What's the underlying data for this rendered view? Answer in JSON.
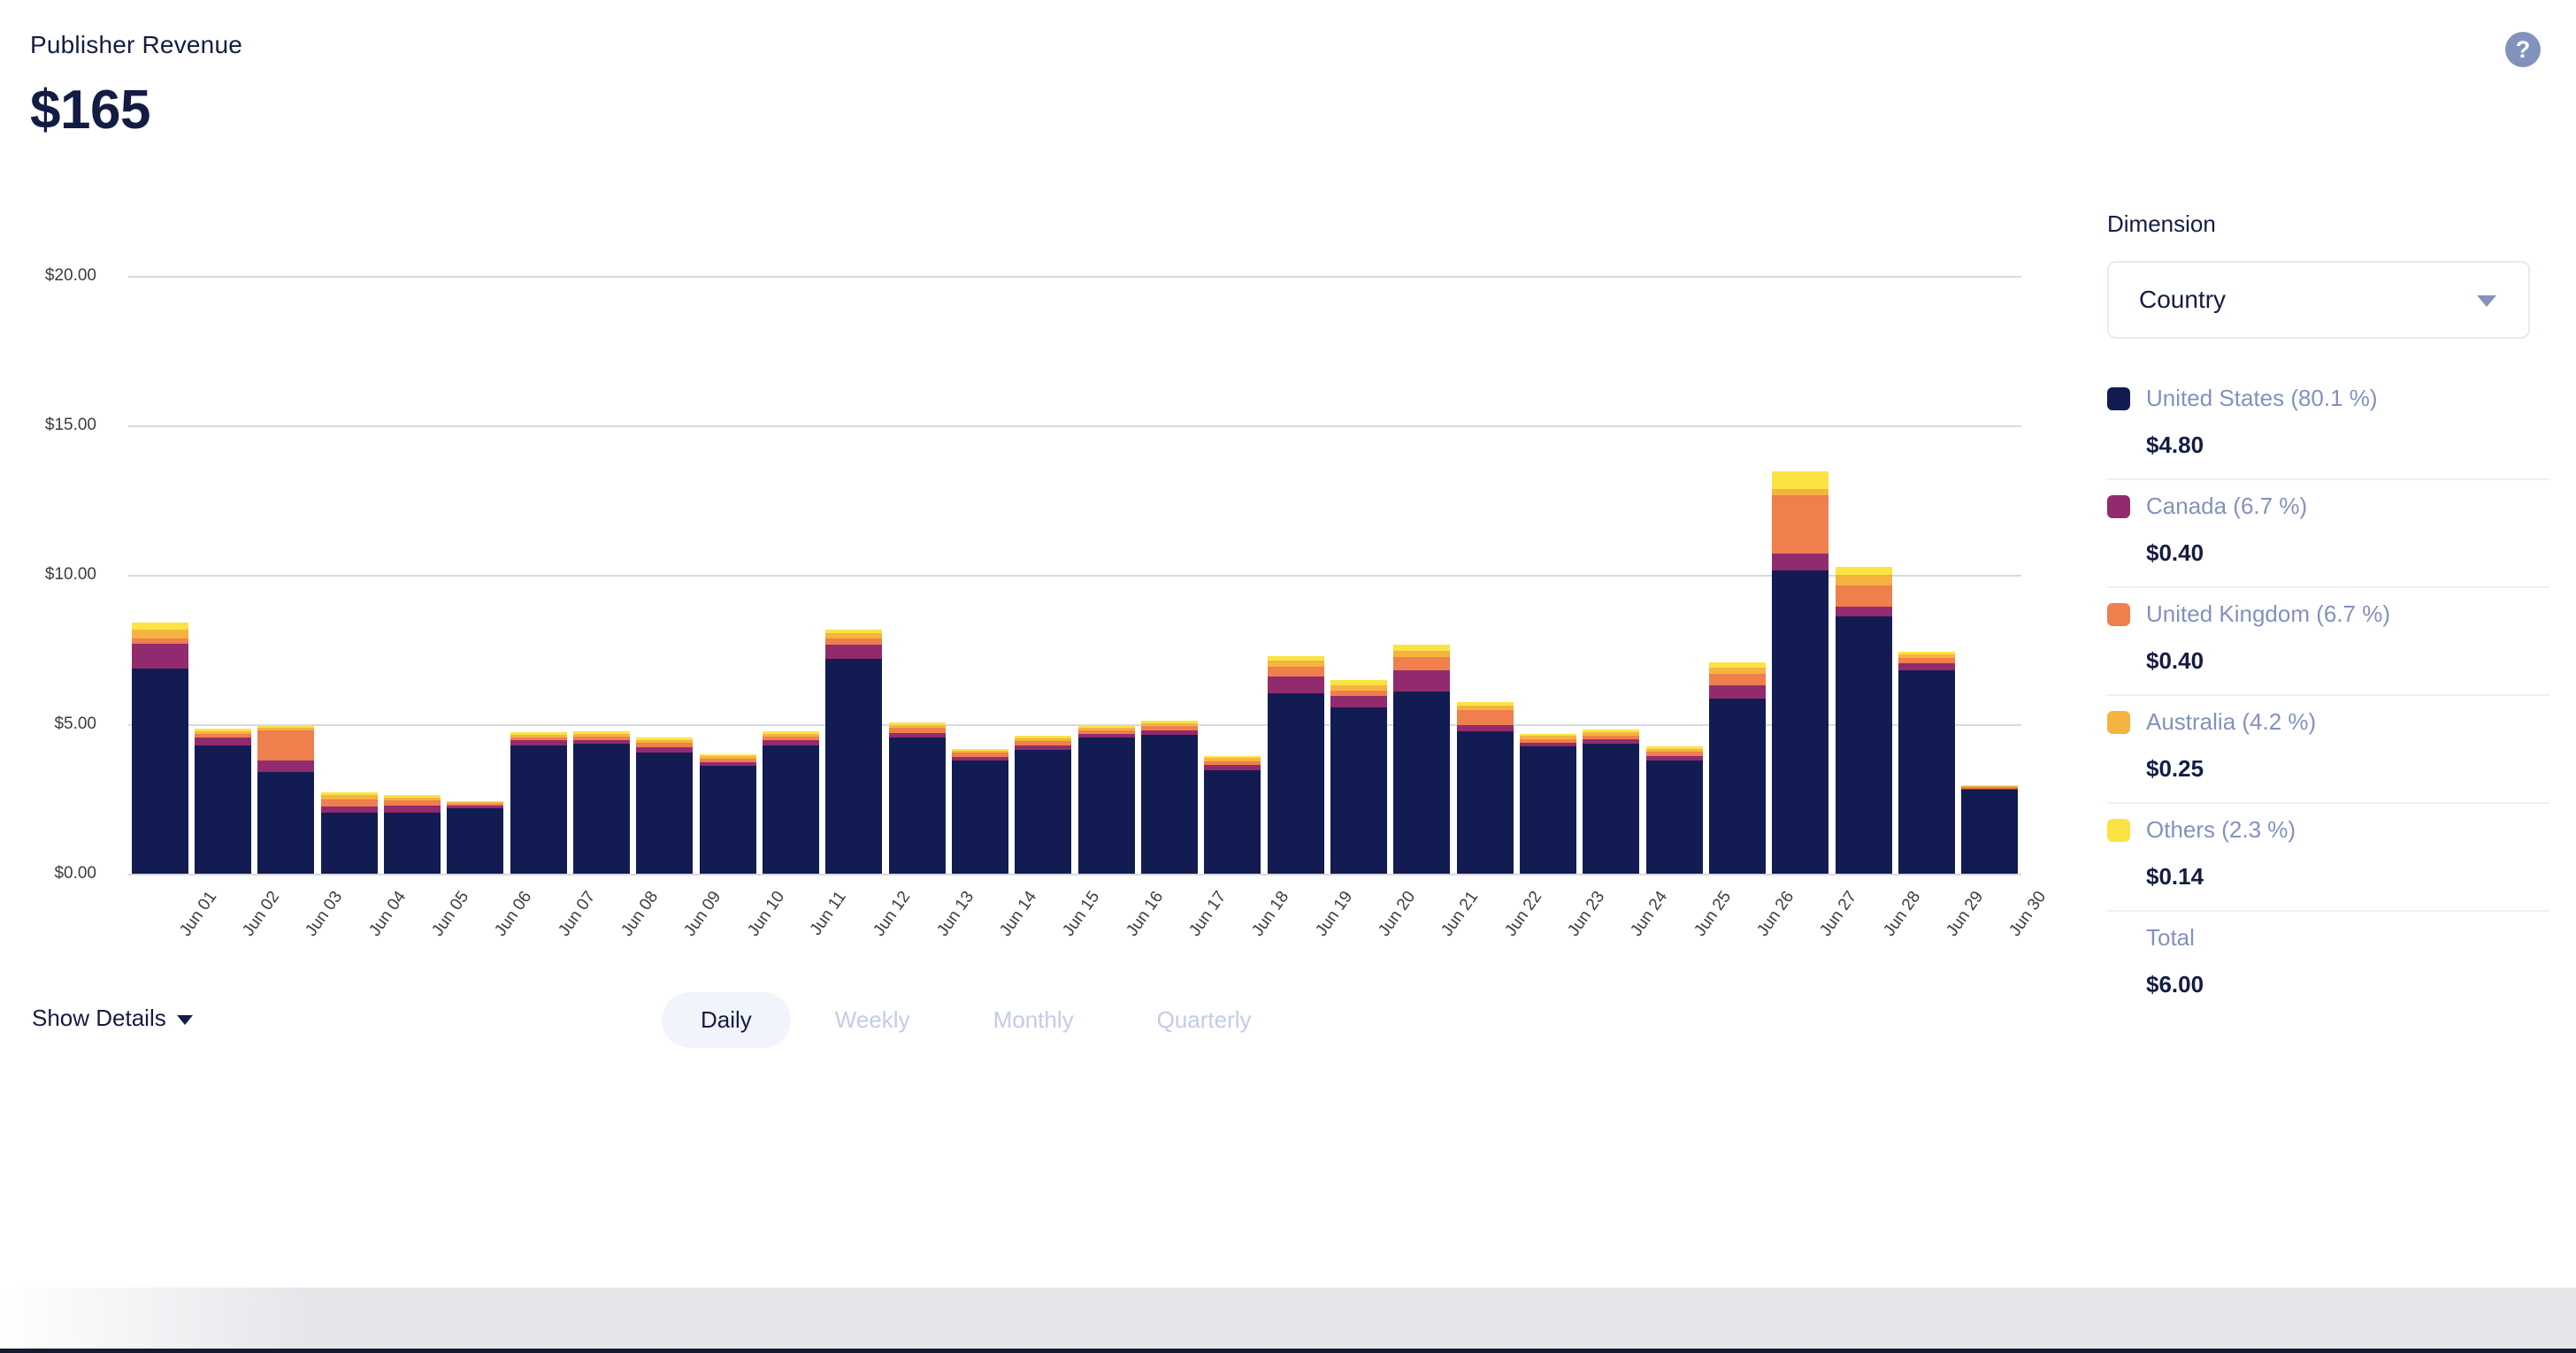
{
  "header": {
    "title": "Publisher Revenue",
    "value": "$165",
    "help_icon": "?"
  },
  "sidebar": {
    "dimension_label": "Dimension",
    "dimension_value": "Country",
    "dimension_caret": "chevron-down-icon",
    "legend": [
      {
        "name": "United States (80.1 %)",
        "value": "$4.80",
        "color": "#121c52"
      },
      {
        "name": "Canada (6.7 %)",
        "value": "$0.40",
        "color": "#912b6d"
      },
      {
        "name": "United Kingdom (6.7 %)",
        "value": "$0.40",
        "color": "#ef7f4c"
      },
      {
        "name": "Australia (4.2 %)",
        "value": "$0.25",
        "color": "#f5b340"
      },
      {
        "name": "Others (2.3 %)",
        "value": "$0.14",
        "color": "#fae343"
      }
    ],
    "total_label": "Total",
    "total_value": "$6.00"
  },
  "footer": {
    "show_details": "Show Details",
    "tabs": [
      {
        "label": "Daily",
        "active": true
      },
      {
        "label": "Weekly",
        "active": false
      },
      {
        "label": "Monthly",
        "active": false
      },
      {
        "label": "Quarterly",
        "active": false
      }
    ]
  },
  "chart_data": {
    "type": "bar",
    "stacked": true,
    "title": "Publisher Revenue",
    "xlabel": "",
    "ylabel": "",
    "ylim": [
      0,
      20
    ],
    "grid": true,
    "legend_position": "right",
    "ytick_labels": [
      "$0.00",
      "$5.00",
      "$10.00",
      "$15.00",
      "$20.00"
    ],
    "ytick_values": [
      0,
      5,
      10,
      15,
      20
    ],
    "categories": [
      "Jun 01",
      "Jun 02",
      "Jun 03",
      "Jun 04",
      "Jun 05",
      "Jun 06",
      "Jun 07",
      "Jun 08",
      "Jun 09",
      "Jun 10",
      "Jun 11",
      "Jun 12",
      "Jun 13",
      "Jun 14",
      "Jun 15",
      "Jun 16",
      "Jun 17",
      "Jun 18",
      "Jun 19",
      "Jun 20",
      "Jun 21",
      "Jun 22",
      "Jun 23",
      "Jun 24",
      "Jun 25",
      "Jun 26",
      "Jun 27",
      "Jun 28",
      "Jun 29",
      "Jun 30"
    ],
    "series": [
      {
        "name": "United States (80.1 %)",
        "color": "#121c52",
        "values": [
          6.85,
          4.3,
          3.4,
          2.05,
          2.05,
          2.2,
          4.3,
          4.35,
          4.05,
          3.6,
          4.3,
          7.2,
          4.55,
          3.8,
          4.15,
          4.55,
          4.65,
          3.45,
          6.05,
          5.55,
          6.1,
          4.75,
          4.25,
          4.35,
          3.8,
          5.85,
          10.15,
          8.6,
          6.8,
          2.8
        ]
      },
      {
        "name": "Canada (6.7 %)",
        "color": "#912b6d",
        "values": [
          0.85,
          0.25,
          0.4,
          0.2,
          0.22,
          0.08,
          0.16,
          0.12,
          0.18,
          0.14,
          0.16,
          0.45,
          0.15,
          0.12,
          0.14,
          0.12,
          0.14,
          0.18,
          0.55,
          0.4,
          0.7,
          0.22,
          0.12,
          0.14,
          0.14,
          0.45,
          0.55,
          0.35,
          0.24,
          0.05
        ]
      },
      {
        "name": "United Kingdom (6.7 %)",
        "color": "#ef7f4c",
        "values": [
          0.18,
          0.12,
          1.0,
          0.25,
          0.18,
          0.05,
          0.1,
          0.12,
          0.14,
          0.12,
          0.12,
          0.22,
          0.18,
          0.12,
          0.14,
          0.12,
          0.14,
          0.14,
          0.32,
          0.18,
          0.45,
          0.5,
          0.14,
          0.14,
          0.14,
          0.4,
          1.95,
          0.7,
          0.18,
          0.04
        ]
      },
      {
        "name": "Australia (4.2 %)",
        "color": "#f5b340",
        "values": [
          0.3,
          0.1,
          0.08,
          0.12,
          0.1,
          0.06,
          0.1,
          0.1,
          0.1,
          0.08,
          0.1,
          0.18,
          0.1,
          0.08,
          0.1,
          0.1,
          0.1,
          0.1,
          0.2,
          0.18,
          0.22,
          0.16,
          0.1,
          0.1,
          0.1,
          0.2,
          0.22,
          0.34,
          0.12,
          0.04
        ]
      },
      {
        "name": "Others (2.3 %)",
        "color": "#fae343",
        "values": [
          0.22,
          0.08,
          0.06,
          0.1,
          0.08,
          0.05,
          0.08,
          0.08,
          0.08,
          0.06,
          0.08,
          0.12,
          0.08,
          0.06,
          0.08,
          0.08,
          0.08,
          0.08,
          0.16,
          0.16,
          0.2,
          0.12,
          0.08,
          0.08,
          0.08,
          0.18,
          0.6,
          0.28,
          0.1,
          0.03
        ]
      }
    ]
  }
}
